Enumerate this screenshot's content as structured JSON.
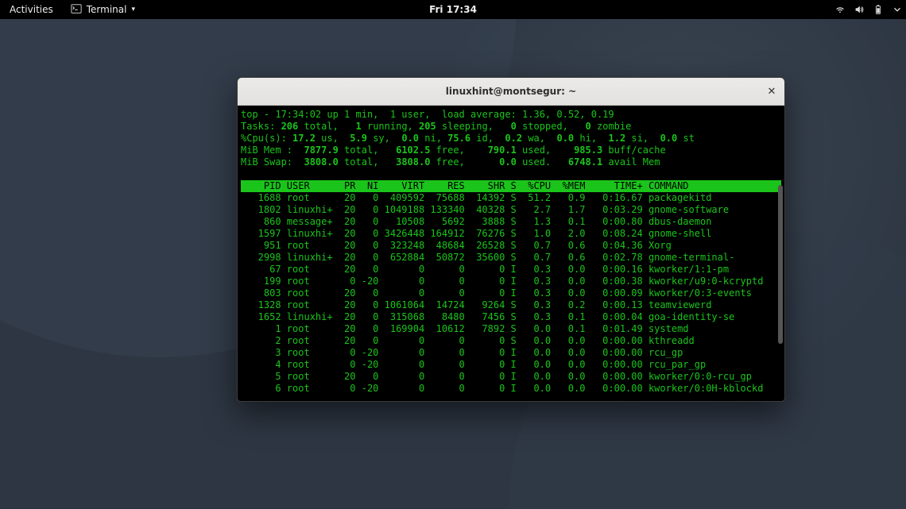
{
  "topbar": {
    "activities": "Activities",
    "app_indicator": "Terminal",
    "clock": "Fri 17:34"
  },
  "window": {
    "title": "linuxhint@montsegur: ~"
  },
  "top": {
    "line1_prefix": "top - ",
    "time": "17:34:02",
    "uptime": " up 1 min,  1 user,  load average: ",
    "load": "1.36, 0.52, 0.19",
    "tasks_label": "Tasks: ",
    "tasks_total": "206",
    "tasks_total_l": " total,   ",
    "tasks_running": "1",
    "tasks_running_l": " running, ",
    "tasks_sleeping": "205",
    "tasks_sleeping_l": " sleeping,   ",
    "tasks_stopped": "0",
    "tasks_stopped_l": " stopped,   ",
    "tasks_zombie": "0",
    "tasks_zombie_l": " zombie",
    "cpu_label": "%Cpu(s): ",
    "cpu_us": "17.2",
    "cpu_us_l": " us,  ",
    "cpu_sy": "5.9",
    "cpu_sy_l": " sy,  ",
    "cpu_ni": "0.0",
    "cpu_ni_l": " ni, ",
    "cpu_id": "75.6",
    "cpu_id_l": " id,  ",
    "cpu_wa": "0.2",
    "cpu_wa_l": " wa,  ",
    "cpu_hi": "0.0",
    "cpu_hi_l": " hi,  ",
    "cpu_si": "1.2",
    "cpu_si_l": " si,  ",
    "cpu_st": "0.0",
    "cpu_st_l": " st",
    "mem_label": "MiB Mem :  ",
    "mem_total": "7877.9",
    "mem_total_l": " total,   ",
    "mem_free": "6102.5",
    "mem_free_l": " free,    ",
    "mem_used": "790.1",
    "mem_used_l": " used,    ",
    "mem_buff": "985.3",
    "mem_buff_l": " buff/cache",
    "swap_label": "MiB Swap:  ",
    "swap_total": "3808.0",
    "swap_total_l": " total,   ",
    "swap_free": "3808.0",
    "swap_free_l": " free,      ",
    "swap_used": "0.0",
    "swap_used_l": " used.   ",
    "swap_avail": "6748.1",
    "swap_avail_l": " avail Mem"
  },
  "columns": "    PID USER      PR  NI    VIRT    RES    SHR S  %CPU  %MEM     TIME+ COMMAND                 ",
  "processes": [
    {
      "pid": "1688",
      "user": "root    ",
      "pr": "20",
      "ni": "  0",
      "virt": " 409592",
      "res": " 75688",
      "shr": "14392",
      "s": "S",
      "cpu": " 51.2",
      "mem": " 0.9",
      "time": "  0:16.67",
      "cmd": "packagekitd"
    },
    {
      "pid": "1802",
      "user": "linuxhi+",
      "pr": "20",
      "ni": "  0",
      "virt": "1049188",
      "res": "133340",
      "shr": "40328",
      "s": "S",
      "cpu": "  2.7",
      "mem": " 1.7",
      "time": "  0:03.29",
      "cmd": "gnome-software"
    },
    {
      "pid": " 860",
      "user": "message+",
      "pr": "20",
      "ni": "  0",
      "virt": "  10508",
      "res": "  5692",
      "shr": " 3888",
      "s": "S",
      "cpu": "  1.3",
      "mem": " 0.1",
      "time": "  0:00.80",
      "cmd": "dbus-daemon"
    },
    {
      "pid": "1597",
      "user": "linuxhi+",
      "pr": "20",
      "ni": "  0",
      "virt": "3426448",
      "res": "164912",
      "shr": "76276",
      "s": "S",
      "cpu": "  1.0",
      "mem": " 2.0",
      "time": "  0:08.24",
      "cmd": "gnome-shell"
    },
    {
      "pid": " 951",
      "user": "root    ",
      "pr": "20",
      "ni": "  0",
      "virt": " 323248",
      "res": " 48684",
      "shr": "26528",
      "s": "S",
      "cpu": "  0.7",
      "mem": " 0.6",
      "time": "  0:04.36",
      "cmd": "Xorg"
    },
    {
      "pid": "2998",
      "user": "linuxhi+",
      "pr": "20",
      "ni": "  0",
      "virt": " 652884",
      "res": " 50872",
      "shr": "35600",
      "s": "S",
      "cpu": "  0.7",
      "mem": " 0.6",
      "time": "  0:02.78",
      "cmd": "gnome-terminal-"
    },
    {
      "pid": "  67",
      "user": "root    ",
      "pr": "20",
      "ni": "  0",
      "virt": "      0",
      "res": "     0",
      "shr": "    0",
      "s": "I",
      "cpu": "  0.3",
      "mem": " 0.0",
      "time": "  0:00.16",
      "cmd": "kworker/1:1-pm"
    },
    {
      "pid": " 199",
      "user": "root    ",
      "pr": " 0",
      "ni": "-20",
      "virt": "      0",
      "res": "     0",
      "shr": "    0",
      "s": "I",
      "cpu": "  0.3",
      "mem": " 0.0",
      "time": "  0:00.38",
      "cmd": "kworker/u9:0-kcryptd"
    },
    {
      "pid": " 803",
      "user": "root    ",
      "pr": "20",
      "ni": "  0",
      "virt": "      0",
      "res": "     0",
      "shr": "    0",
      "s": "I",
      "cpu": "  0.3",
      "mem": " 0.0",
      "time": "  0:00.09",
      "cmd": "kworker/0:3-events"
    },
    {
      "pid": "1328",
      "user": "root    ",
      "pr": "20",
      "ni": "  0",
      "virt": "1061064",
      "res": " 14724",
      "shr": " 9264",
      "s": "S",
      "cpu": "  0.3",
      "mem": " 0.2",
      "time": "  0:00.13",
      "cmd": "teamviewerd"
    },
    {
      "pid": "1652",
      "user": "linuxhi+",
      "pr": "20",
      "ni": "  0",
      "virt": " 315068",
      "res": "  8480",
      "shr": " 7456",
      "s": "S",
      "cpu": "  0.3",
      "mem": " 0.1",
      "time": "  0:00.04",
      "cmd": "goa-identity-se"
    },
    {
      "pid": "   1",
      "user": "root    ",
      "pr": "20",
      "ni": "  0",
      "virt": " 169904",
      "res": " 10612",
      "shr": " 7892",
      "s": "S",
      "cpu": "  0.0",
      "mem": " 0.1",
      "time": "  0:01.49",
      "cmd": "systemd"
    },
    {
      "pid": "   2",
      "user": "root    ",
      "pr": "20",
      "ni": "  0",
      "virt": "      0",
      "res": "     0",
      "shr": "    0",
      "s": "S",
      "cpu": "  0.0",
      "mem": " 0.0",
      "time": "  0:00.00",
      "cmd": "kthreadd"
    },
    {
      "pid": "   3",
      "user": "root    ",
      "pr": " 0",
      "ni": "-20",
      "virt": "      0",
      "res": "     0",
      "shr": "    0",
      "s": "I",
      "cpu": "  0.0",
      "mem": " 0.0",
      "time": "  0:00.00",
      "cmd": "rcu_gp"
    },
    {
      "pid": "   4",
      "user": "root    ",
      "pr": " 0",
      "ni": "-20",
      "virt": "      0",
      "res": "     0",
      "shr": "    0",
      "s": "I",
      "cpu": "  0.0",
      "mem": " 0.0",
      "time": "  0:00.00",
      "cmd": "rcu_par_gp"
    },
    {
      "pid": "   5",
      "user": "root    ",
      "pr": "20",
      "ni": "  0",
      "virt": "      0",
      "res": "     0",
      "shr": "    0",
      "s": "I",
      "cpu": "  0.0",
      "mem": " 0.0",
      "time": "  0:00.00",
      "cmd": "kworker/0:0-rcu_gp"
    },
    {
      "pid": "   6",
      "user": "root    ",
      "pr": " 0",
      "ni": "-20",
      "virt": "      0",
      "res": "     0",
      "shr": "    0",
      "s": "I",
      "cpu": "  0.0",
      "mem": " 0.0",
      "time": "  0:00.00",
      "cmd": "kworker/0:0H-kblockd"
    }
  ]
}
